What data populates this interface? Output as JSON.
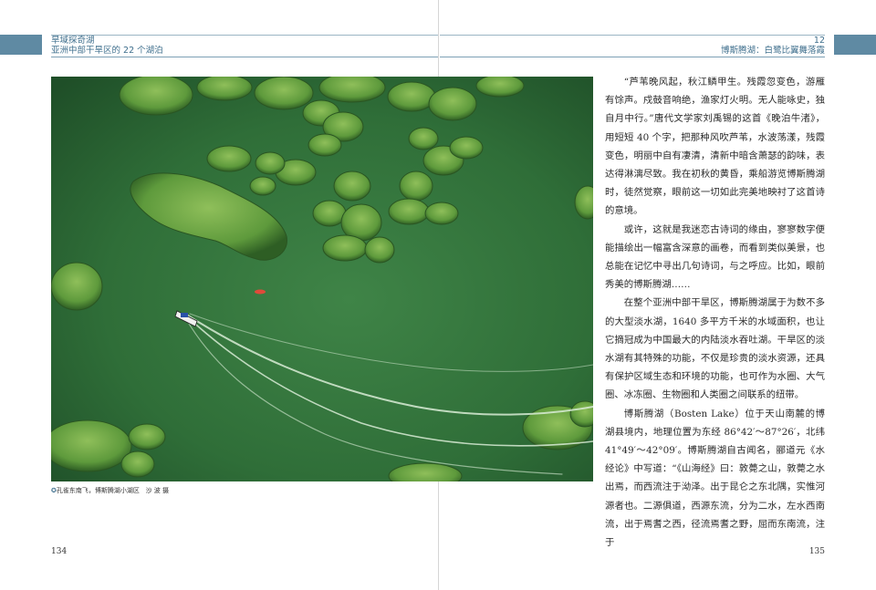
{
  "header": {
    "series_title": "旱域探奇湖",
    "section_title": "亚洲中部干旱区的 22 个湖泊",
    "chapter_number": "12",
    "chapter_title": "博斯腾湖：白鹭比翼舞落霞"
  },
  "photo": {
    "caption_marker": "✪",
    "caption": "孔雀东南飞，博斯腾湖小湖区",
    "credit": "沙 波 摄"
  },
  "body": {
    "paragraphs": [
      "“芦苇晚风起，秋江鳞甲生。残霞忽变色，游雁有馀声。戍鼓音响绝，渔家灯火明。无人能咏史，独自月中行。”唐代文学家刘禹锡的这首《晚泊牛渚》，用短短 40 个字，把那种风吹芦苇，水波荡漾，残霞变色，明丽中自有凄清，清新中暗含萧瑟的韵味，表达得淋漓尽致。我在初秋的黄昏，乘船游览博斯腾湖时，徒然觉察，眼前这一切如此完美地映衬了这首诗的意境。",
      "或许，这就是我迷恋古诗词的缘由，寥寥数字便能描绘出一幅富含深意的画卷，而看到类似美景，也总能在记忆中寻出几句诗词，与之呼应。比如，眼前秀美的博斯腾湖……",
      "在整个亚洲中部干旱区，博斯腾湖属于为数不多的大型淡水湖，1640 多平方千米的水域面积，也让它摘冠成为中国最大的内陆淡水吞吐湖。干旱区的淡水湖有其特殊的功能，不仅是珍贵的淡水资源，还具有保护区域生态和环境的功能，也可作为水圈、大气圈、冰冻圈、生物圈和人类圈之间联系的纽带。",
      "博斯腾湖（Bosten Lake）位于天山南麓的博湖县境内，地理位置为东经 86°42′～87°26′，北纬 41°49′～42°09′。博斯腾湖自古闻名，郦道元《水经论》中写道：“《山海经》曰：敦薨之山，敦薨之水出焉，而西流注于泑泽。出于昆仑之东北隅，实惟河源者也。二源俱道，西源东流，分为二水，左水西南流，出于焉耆之西，径流焉耆之野，屈而东南流，注于"
    ]
  },
  "folio": {
    "left": "134",
    "right": "135"
  }
}
